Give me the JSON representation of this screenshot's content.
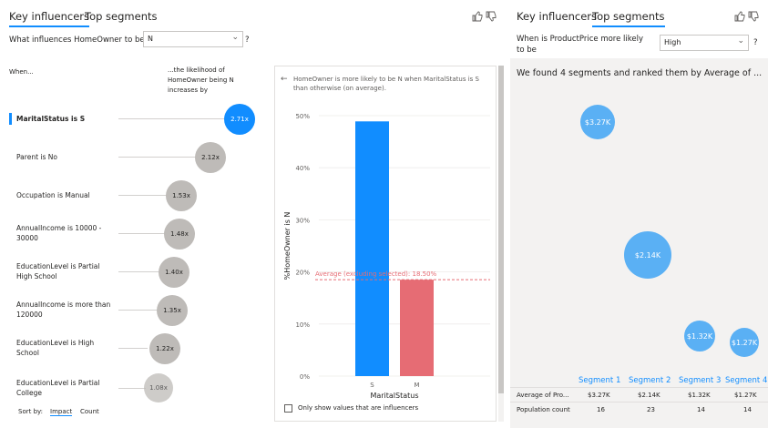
{
  "left": {
    "tabs": [
      "Key influencers",
      "Top segments"
    ],
    "question": "What influences HomeOwner to be",
    "selected_value": "N",
    "help": "?",
    "col_when": "When...",
    "col_likelihood": "...the likelihood of HomeOwner being N increases by",
    "influencers": [
      {
        "label": "MaritalStatus is S",
        "value": "2.71x"
      },
      {
        "label": "Parent is No",
        "value": "2.12x"
      },
      {
        "label": "Occupation is Manual",
        "value": "1.53x"
      },
      {
        "label": "AnnualIncome is 10000 - 30000",
        "value": "1.48x"
      },
      {
        "label": "EducationLevel is Partial High School",
        "value": "1.40x"
      },
      {
        "label": "AnnualIncome is more than 120000",
        "value": "1.35x"
      },
      {
        "label": "EducationLevel is High School",
        "value": "1.22x"
      },
      {
        "label": "EducationLevel is Partial College",
        "value": "1.08x"
      }
    ],
    "sort_by": "Sort by:",
    "sort_impact": "Impact",
    "sort_count": "Count"
  },
  "detail": {
    "back": "←",
    "header": "HomeOwner is more likely to be N when MaritalStatus is S than otherwise (on average).",
    "only_influencers": "Only show values that are influencers",
    "avg_label": "Average (excluding selected): 18.50%"
  },
  "chart_data": {
    "type": "bar",
    "categories": [
      "S",
      "M"
    ],
    "values": [
      48.9,
      18.5
    ],
    "xlabel": "MaritalStatus",
    "ylabel": "%HomeOwner is N",
    "ylim": [
      0,
      50
    ],
    "yticks": [
      "0%",
      "10%",
      "20%",
      "30%",
      "40%",
      "50%"
    ],
    "colors": [
      "#118DFF",
      "#E66C74"
    ],
    "average": 18.5
  },
  "right": {
    "tabs": [
      "Key influencers",
      "Top segments"
    ],
    "question": "When is ProductPrice more likely to be",
    "selected_value": "High",
    "help": "?",
    "summary": "We found 4 segments and ranked them by Average of ...",
    "segments": [
      {
        "name": "Segment 1",
        "bubble": "$3.27K",
        "avg": "$3.27K",
        "pop": "16"
      },
      {
        "name": "Segment 2",
        "bubble": "$2.14K",
        "avg": "$2.14K",
        "pop": "23"
      },
      {
        "name": "Segment 3",
        "bubble": "$1.32K",
        "avg": "$1.32K",
        "pop": "14"
      },
      {
        "name": "Segment 4",
        "bubble": "$1.27K",
        "avg": "$1.27K",
        "pop": "14"
      }
    ],
    "row_avg": "Average of Pro...",
    "row_pop": "Population count"
  },
  "icons": [
    "thumbs-up-icon",
    "thumbs-down-icon",
    "chevron-down-icon",
    "back-arrow-icon"
  ]
}
